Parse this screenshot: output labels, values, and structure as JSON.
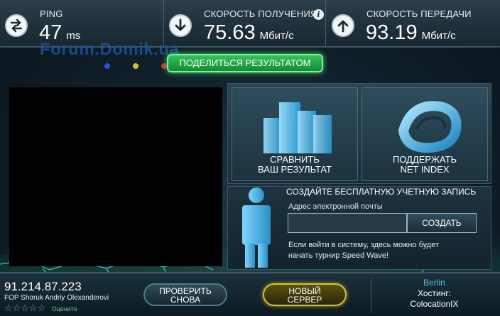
{
  "metrics": {
    "ping": {
      "label": "PING",
      "value": "47",
      "unit": "ms"
    },
    "download": {
      "label": "СКОРОСТЬ ПОЛУЧЕНИЯ",
      "value": "75.63",
      "unit": "Мбит/с"
    },
    "upload": {
      "label": "СКОРОСТЬ ПЕРЕДАЧИ",
      "value": "93.19",
      "unit": "Мбит/с"
    }
  },
  "watermark": "Forum.Domik.ua",
  "share_button": "ПОДЕЛИТЬСЯ РЕЗУЛЬТАТОМ",
  "cards": {
    "compare": {
      "line1": "СРАВНИТЬ",
      "line2": "ВАШ РЕЗУЛЬТАТ"
    },
    "support": {
      "line1": "ПОДДЕРЖАТЬ",
      "line2": "NET INDEX"
    }
  },
  "account": {
    "title": "СОЗДАЙТЕ БЕСПЛАТНУЮ УЧЕТНУЮ ЗАПИСЬ",
    "email_label": "Адрес электронной почты",
    "email_value": "",
    "create_button": "СОЗДАТЬ",
    "desc": "Если войти в систему, здесь можно будет начать турнир Speed Wave!"
  },
  "isp": {
    "ip": "91.214.87.223",
    "name": "FOP Shoruk Andriy Olexanderovi",
    "stars": "☆☆☆☆☆",
    "rate_label": "Оцените"
  },
  "buttons": {
    "retest": {
      "line1": "ПРОВЕРИТЬ",
      "line2": "СНОВА"
    },
    "new_server": {
      "line1": "НОВЫЙ",
      "line2": "СЕРВЕР"
    }
  },
  "server": {
    "city": "Berlin",
    "host_label": "Хостинг:",
    "host_name": "ColocationIX"
  },
  "colors": {
    "accent_green": "#35c25a",
    "map_glow": "#3ddc9a",
    "server_city": "#55c0e8"
  },
  "icons": {
    "ping": "swap-arrows-icon",
    "download": "arrow-down-icon",
    "upload": "arrow-up-icon",
    "info": "info-icon"
  }
}
